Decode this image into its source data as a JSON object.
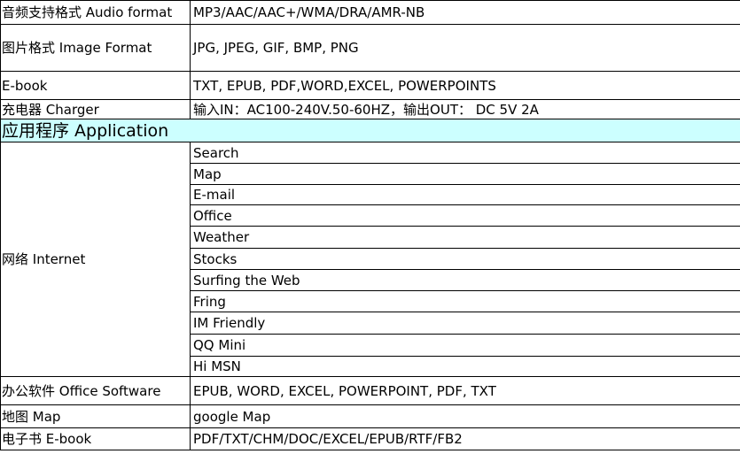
{
  "rows_top": [
    {
      "label": "音频支持格式 Audio format",
      "value": "MP3/AAC/AAC+/WMA/DRA/AMR-NB"
    },
    {
      "label": "图片格式 Image Format",
      "value": "JPG, JPEG, GIF, BMP, PNG"
    },
    {
      "label": "E-book",
      "value": "TXT, EPUB, PDF,WORD,EXCEL, POWERPOINTS"
    },
    {
      "label": "充电器 Charger",
      "value": "输入IN：AC100-240V.50-60HZ，输出OUT： DC 5V  2A"
    }
  ],
  "section_title": "应用程序 Application",
  "internet": {
    "label": "网络 Internet",
    "items": [
      "Search",
      "Map",
      "E-mail",
      "Office",
      "Weather",
      "Stocks",
      "Surfing the Web",
      "Fring",
      "IM  Friendly",
      "QQ Mini",
      "Hi MSN"
    ]
  },
  "rows_bottom": [
    {
      "label": "办公软件 Office Software",
      "value": "EPUB, WORD, EXCEL, POWERPOINT, PDF, TXT"
    },
    {
      "label": "地图 Map",
      "value": "google Map"
    },
    {
      "label": "电子书 E-book",
      "value": "PDF/TXT/CHM/DOC/EXCEL/EPUB/RTF/FB2"
    }
  ]
}
